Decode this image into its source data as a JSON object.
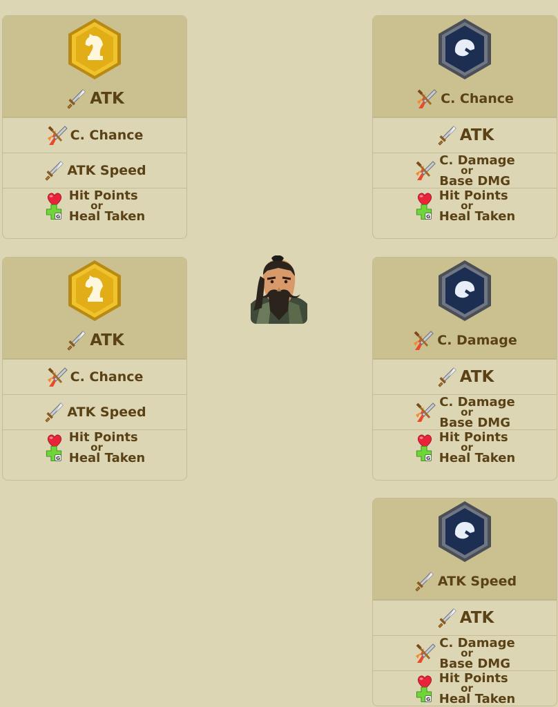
{
  "left_cards": [
    {
      "emblem": "knight-icon",
      "main_stat": "ATK",
      "rows": {
        "r1": "C. Chance",
        "r2": "ATK Speed",
        "r3_top": "Hit Points",
        "r3_or": "or",
        "r3_bottom": "Heal Taken"
      }
    },
    {
      "emblem": "knight-icon",
      "main_stat": "ATK",
      "rows": {
        "r1": "C. Chance",
        "r2": "ATK Speed",
        "r3_top": "Hit Points",
        "r3_or": "or",
        "r3_bottom": "Heal Taken"
      }
    }
  ],
  "right_cards": [
    {
      "emblem": "helmet-icon",
      "main_stat": "C. Chance",
      "rows": {
        "r1": "ATK",
        "r2_top": "C. Damage",
        "r2_or": "or",
        "r2_bottom": "Base DMG",
        "r3_top": "Hit Points",
        "r3_or": "or",
        "r3_bottom": "Heal Taken"
      }
    },
    {
      "emblem": "helmet-icon",
      "main_stat": "C. Damage",
      "rows": {
        "r1": "ATK",
        "r2_top": "C. Damage",
        "r2_or": "or",
        "r2_bottom": "Base DMG",
        "r3_top": "Hit Points",
        "r3_or": "or",
        "r3_bottom": "Heal Taken"
      }
    },
    {
      "emblem": "helmet-icon",
      "main_stat": "ATK Speed",
      "rows": {
        "r1": "ATK",
        "r2_top": "C. Damage",
        "r2_or": "or",
        "r2_bottom": "Base DMG",
        "r3_top": "Hit Points",
        "r3_or": "or",
        "r3_bottom": "Heal Taken"
      }
    }
  ],
  "colors": {
    "background": "#dcd6b4",
    "header": "#cbc08f",
    "text": "#5a4216",
    "gold_emblem": "#e8b820",
    "navy_emblem": "#1c2e52"
  },
  "portrait": "hero-portrait"
}
